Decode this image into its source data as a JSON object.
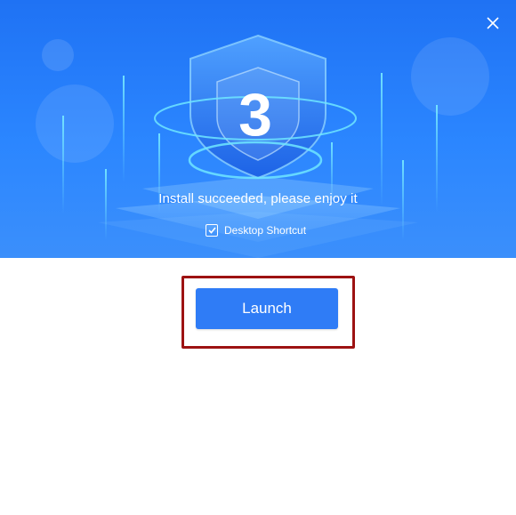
{
  "window": {
    "install_message": "Install succeeded, please enjoy it",
    "close_label": "×"
  },
  "shortcut": {
    "label": "Desktop Shortcut",
    "checked": true
  },
  "launch": {
    "label": "Launch"
  },
  "logo": {
    "glyph": "3"
  },
  "colors": {
    "banner_top": "#1f72f4",
    "banner_bottom": "#3b8ffb",
    "button": "#2f7cf6",
    "highlight_border": "#9d1212"
  }
}
